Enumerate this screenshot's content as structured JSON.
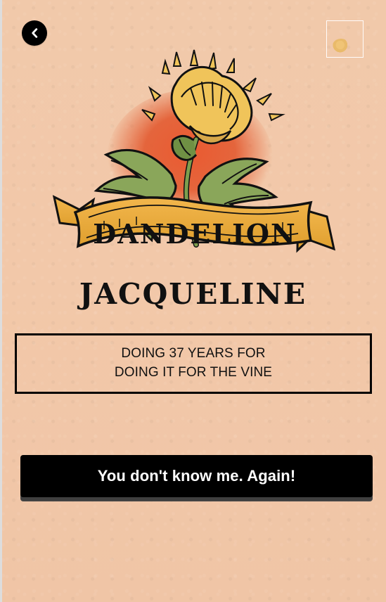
{
  "card": {
    "banner_text": "DANDELION",
    "player_name": "JACQUELINE",
    "sentence_line1": "DOING 37 YEARS FOR",
    "sentence_line2": "DOING IT FOR THE VINE",
    "button_label": "You don't know me. Again!"
  },
  "icons": {
    "back": "chevron-left-icon",
    "corner": "frame-icon"
  },
  "colors": {
    "background": "#f1c8a8",
    "ink": "#111111",
    "banner": "#f0b44a",
    "banner_dark": "#c97f19",
    "leaf": "#8da55a",
    "leaf_dark": "#5f7d3a",
    "flower": "#f0c35c",
    "glow": "#e45d32",
    "button": "#000000",
    "button_shadow": "#3f3f3f"
  }
}
